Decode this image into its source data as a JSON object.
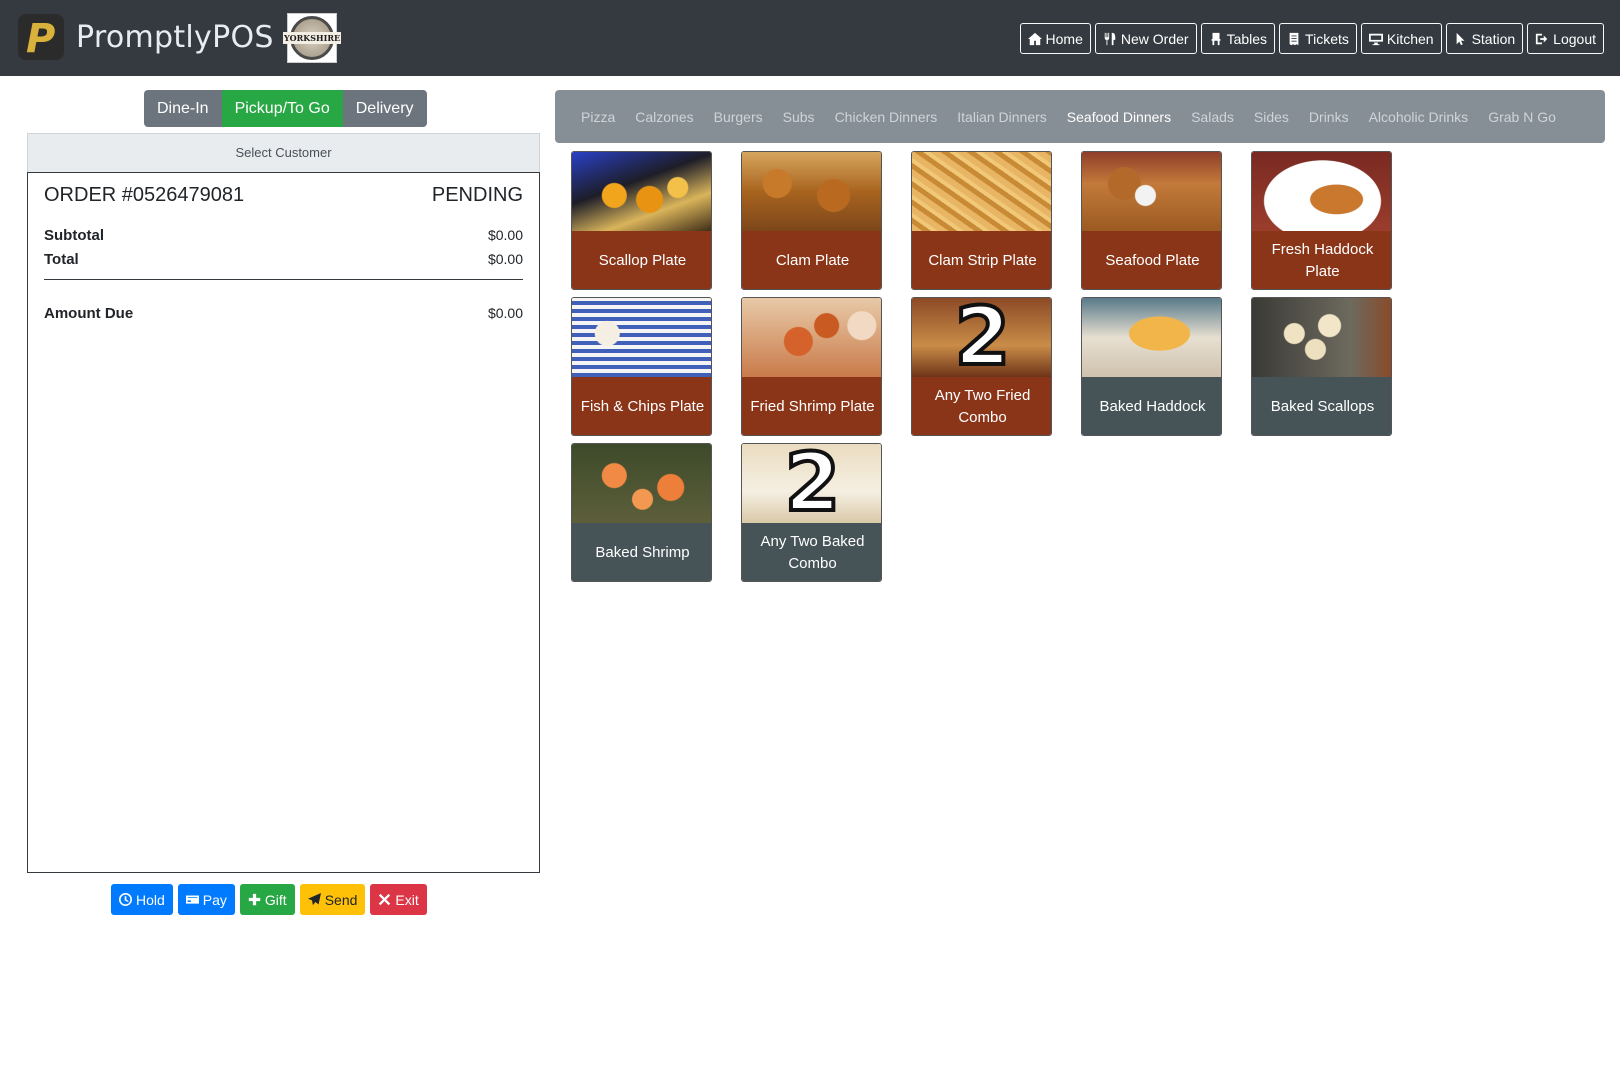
{
  "brand": {
    "name": "PromptlyPOS",
    "logo_text": "YORKSHIRE"
  },
  "nav": [
    {
      "label": "Home",
      "icon": "home-icon"
    },
    {
      "label": "New Order",
      "icon": "utensils-icon"
    },
    {
      "label": "Tables",
      "icon": "chair-icon"
    },
    {
      "label": "Tickets",
      "icon": "receipt-icon"
    },
    {
      "label": "Kitchen",
      "icon": "desktop-icon"
    },
    {
      "label": "Station",
      "icon": "pointer-icon"
    },
    {
      "label": "Logout",
      "icon": "sign-out-icon"
    }
  ],
  "order_type": {
    "options": [
      "Dine-In",
      "Pickup/To Go",
      "Delivery"
    ],
    "selected": "Pickup/To Go"
  },
  "customer": {
    "label": "Select Customer"
  },
  "order": {
    "number": "ORDER #0526479081",
    "status": "PENDING",
    "subtotal_label": "Subtotal",
    "subtotal": "$0.00",
    "total_label": "Total",
    "total": "$0.00",
    "amount_due_label": "Amount Due",
    "amount_due": "$0.00"
  },
  "actions": [
    {
      "label": "Hold",
      "icon": "clock-icon",
      "color": "#007bff"
    },
    {
      "label": "Pay",
      "icon": "credit-card-icon",
      "color": "#007bff"
    },
    {
      "label": "Gift",
      "icon": "plus-icon",
      "color": "#28a745"
    },
    {
      "label": "Send",
      "icon": "paper-plane-icon",
      "color": "#ffc107"
    },
    {
      "label": "Exit",
      "icon": "times-icon",
      "color": "#dc3545"
    }
  ],
  "categories": {
    "items": [
      "Pizza",
      "Calzones",
      "Burgers",
      "Subs",
      "Chicken Dinners",
      "Italian Dinners",
      "Seafood Dinners",
      "Salads",
      "Sides",
      "Drinks",
      "Alcoholic Drinks",
      "Grab N Go"
    ],
    "active": "Seafood Dinners"
  },
  "menu_items": [
    {
      "name": "Scallop Plate",
      "style": "brown"
    },
    {
      "name": "Clam Plate",
      "style": "brown"
    },
    {
      "name": "Clam Strip Plate",
      "style": "brown"
    },
    {
      "name": "Seafood Plate",
      "style": "brown"
    },
    {
      "name": "Fresh Haddock Plate",
      "style": "brown"
    },
    {
      "name": "Fish & Chips Plate",
      "style": "brown"
    },
    {
      "name": "Fried Shrimp Plate",
      "style": "brown"
    },
    {
      "name": "Any Two Fried Combo",
      "style": "brown",
      "badge": "2"
    },
    {
      "name": "Baked Haddock",
      "style": "slate"
    },
    {
      "name": "Baked Scallops",
      "style": "slate"
    },
    {
      "name": "Baked Shrimp",
      "style": "slate"
    },
    {
      "name": "Any Two Baked Combo",
      "style": "slate",
      "badge": "2"
    }
  ],
  "colors": {
    "navbar": "#343a40",
    "active_green": "#28a745",
    "tile_brown": "#8b3518",
    "tile_slate": "#465357"
  }
}
